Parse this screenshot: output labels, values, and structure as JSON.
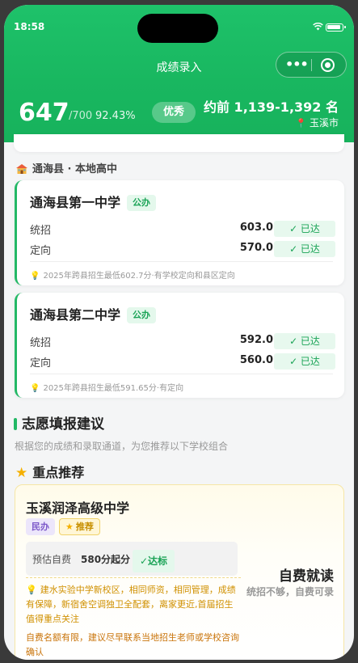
{
  "status": {
    "time": "18:58"
  },
  "nav": {
    "title": "成绩录入",
    "more_icon": "•••"
  },
  "summary": {
    "score": "647",
    "total": "/700",
    "percent": "92.43%",
    "level": "优秀",
    "rank": "约前 1,139-1,392 名",
    "city": "玉溪市"
  },
  "section": {
    "title": "通海县 · 本地高中"
  },
  "schools": [
    {
      "name": "通海县第一中学",
      "tag": "公办",
      "rows": [
        {
          "label": "统招",
          "value": "603.0",
          "status": "✓ 已达"
        },
        {
          "label": "定向",
          "value": "570.0",
          "status": "✓ 已达"
        }
      ],
      "note": "2025年跨县招生最低602.7分·有学校定向和县区定向"
    },
    {
      "name": "通海县第二中学",
      "tag": "公办",
      "rows": [
        {
          "label": "统招",
          "value": "592.0",
          "status": "✓ 已达"
        },
        {
          "label": "定向",
          "value": "560.0",
          "status": "✓ 已达"
        }
      ],
      "note": "2025年跨县招生最低591.65分·有定向"
    }
  ],
  "advice": {
    "title": "志愿填报建议",
    "subtitle": "根据您的成绩和录取通道，为您推荐以下学校组合",
    "key_title": "重点推荐",
    "rec": {
      "name": "玉溪润泽高级中学",
      "tag_private": "民办",
      "tag_recommend": "推荐",
      "box_label": "预估自费",
      "box_value": "580分起分",
      "box_status": "✓达标",
      "side_title": "自费就读",
      "side_sub": "统招不够，自费可录",
      "note": "建水实验中学新校区，相同师资，相同管理，成绩有保障，新宿舍空调独卫全配套，离家更近,首届招生值得重点关注",
      "note2": "自费名额有限，建议尽早联系当地招生老师或学校咨询确认"
    }
  },
  "colors": {
    "brand": "#1ec26a",
    "ok": "#1aa356",
    "warn": "#d09000"
  }
}
